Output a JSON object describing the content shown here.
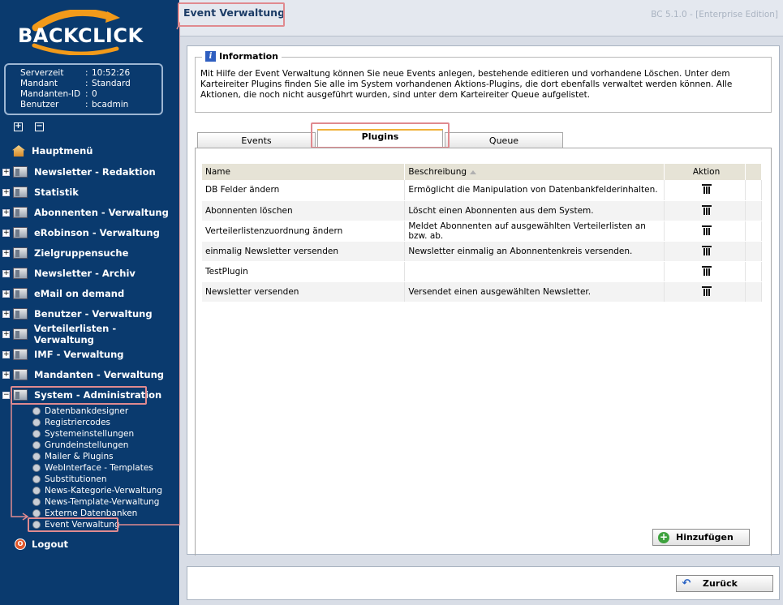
{
  "brand": {
    "logo_text": "BACKCLICK"
  },
  "server_info": [
    {
      "key": "Serverzeit",
      "sep": ":",
      "value": "10:52:26"
    },
    {
      "key": "Mandant",
      "sep": ":",
      "value": "Standard"
    },
    {
      "key": "Mandanten-ID",
      "sep": ":",
      "value": "0"
    },
    {
      "key": "Benutzer",
      "sep": ":",
      "value": "bcadmin"
    }
  ],
  "tree_controls": {
    "expand": "+",
    "collapse": "−"
  },
  "nav": {
    "main_menu": "Hauptmenü",
    "items": [
      "Newsletter - Redaktion",
      "Statistik",
      "Abonnenten - Verwaltung",
      "eRobinson - Verwaltung",
      "Zielgruppensuche",
      "Newsletter - Archiv",
      "eMail on demand",
      "Benutzer - Verwaltung",
      "Verteilerlisten - Verwaltung",
      "IMF - Verwaltung",
      "Mandanten - Verwaltung",
      "System - Administration"
    ],
    "sub_items": [
      "Datenbankdesigner",
      "Registriercodes",
      "Systemeinstellungen",
      "Grundeinstellungen",
      "Mailer & Plugins",
      "WebInterface - Templates",
      "Substitutionen",
      "News-Kategorie-Verwaltung",
      "News-Template-Verwaltung",
      "Externe Datenbanken",
      "Event Verwaltung"
    ],
    "logout": "Logout"
  },
  "header": {
    "title": "Event Verwaltung",
    "version": "BC 5.1.0 - [Enterprise Edition]"
  },
  "info": {
    "legend": "Information",
    "text": "Mit Hilfe der Event Verwaltung können Sie neue Events anlegen, bestehende editieren und vorhandene Löschen. Unter dem Karteireiter Plugins finden Sie alle im System vorhandenen Aktions-Plugins, die dort ebenfalls verwaltet werden können. Alle Aktionen, die noch nicht ausgeführt wurden, sind unter dem Karteireiter Queue aufgelistet."
  },
  "tabs": {
    "events": "Events",
    "plugins": "Plugins",
    "queue": "Queue",
    "active": "Plugins"
  },
  "grid": {
    "columns": {
      "name": "Name",
      "beschreibung": "Beschreibung",
      "aktion": "Aktion"
    },
    "rows": [
      {
        "name": "DB Felder ändern",
        "beschreibung": "Ermöglicht die Manipulation von Datenbankfelderinhalten."
      },
      {
        "name": "Abonnenten löschen",
        "beschreibung": "Löscht einen Abonnenten aus dem System."
      },
      {
        "name": "Verteilerlistenzuordnung ändern",
        "beschreibung": "Meldet Abonnenten auf ausgewählten Verteilerlisten an bzw. ab."
      },
      {
        "name": "einmalig Newsletter versenden",
        "beschreibung": "Newsletter einmalig an Abonnentenkreis versenden."
      },
      {
        "name": "TestPlugin",
        "beschreibung": ""
      },
      {
        "name": "Newsletter versenden",
        "beschreibung": "Versendet einen ausgewählten Newsletter."
      }
    ]
  },
  "buttons": {
    "add": "Hinzufügen",
    "back": "Zurück"
  },
  "colors": {
    "sidebar": "#0a3a6e",
    "highlight": "#e08a8f",
    "tab_accent": "#f0b23a"
  }
}
